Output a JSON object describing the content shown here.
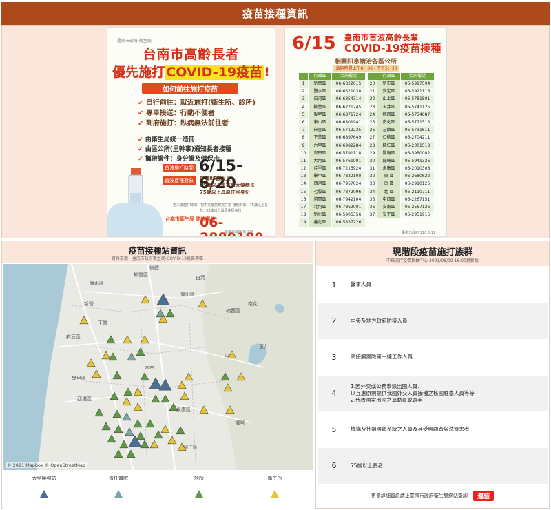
{
  "header": {
    "title": "疫苗接種資訊"
  },
  "poster_left": {
    "org": "臺南市政府 衛生局",
    "title_line1": "台南市高齡長者",
    "title_line2_prefix": "優先施打",
    "title_line2_highlight": "COVID-19疫苗",
    "title_line2_suffix": "!",
    "banner": "如何前往施打疫苗",
    "ways": [
      "自行前往：就近施打(衛生所、診所)",
      "專車接送：行動不便者",
      "到府施打：臥病無法前往者"
    ],
    "steps": [
      "由衛生局統一造冊",
      "由區公所(里幹事)通知長者接種",
      "攜帶證件：身分證及健保卡"
    ],
    "date_tag": "首波施打時間",
    "date": "6/15-6/20",
    "target_tag": "首波接種對象",
    "targets": [
      "年滿85歲以上",
      "75歲以上患有重大傷病卡",
      "75歲以上具原住民身份"
    ],
    "note": "第二波施打時間：視中央疫苗到貨訂定 接種對象：75歲以上長者、65歲以上具原住民身份",
    "hotline_tag": "台南市衛生局 諮詢專線",
    "hotline": "06-2880180",
    "footer": "臺南市政府 衛生局"
  },
  "poster_right": {
    "date": "6/15",
    "title_line1": "臺南市首波高齡長輩",
    "title_line2": "COVID-19疫苗接種",
    "subtitle": "相關訊息請洽各區公所",
    "time": "洽詢時間上午8：00 - 下午5：30",
    "head_no": "",
    "head_district": "行政區",
    "head_phone": "洽詢電話",
    "left_rows": [
      [
        "1",
        "新營區",
        "06-6322015"
      ],
      [
        "2",
        "鹽水區",
        "06-6521038"
      ],
      [
        "3",
        "白河區",
        "06-6854314"
      ],
      [
        "4",
        "柳營區",
        "06-6221245"
      ],
      [
        "5",
        "後壁區",
        "06-6871724"
      ],
      [
        "6",
        "東山區",
        "06-6801941"
      ],
      [
        "7",
        "麻豆區",
        "06-5712235"
      ],
      [
        "8",
        "下營區",
        "06-6897649"
      ],
      [
        "9",
        "六甲區",
        "06-6982284"
      ],
      [
        "10",
        "官田區",
        "06-5791118"
      ],
      [
        "11",
        "大內區",
        "06-5761001"
      ],
      [
        "12",
        "佳里區",
        "06-7215924"
      ],
      [
        "13",
        "學甲區",
        "06-7832100"
      ],
      [
        "14",
        "西港區",
        "06-7957024"
      ],
      [
        "15",
        "七股區",
        "06-7872096"
      ],
      [
        "16",
        "將軍區",
        "06-7942104"
      ],
      [
        "17",
        "北門區",
        "06-7862001"
      ],
      [
        "18",
        "新化區",
        "06-5905356"
      ],
      [
        "19",
        "善化區",
        "06-5837226"
      ]
    ],
    "right_rows": [
      [
        "20",
        "新市區",
        "06-5997594"
      ],
      [
        "21",
        "安定區",
        "06-5921116"
      ],
      [
        "22",
        "山上區",
        "06-5781801"
      ],
      [
        "23",
        "玉井區",
        "06-5741125"
      ],
      [
        "24",
        "楠西區",
        "06-5754687"
      ],
      [
        "25",
        "南化區",
        "06-5771513"
      ],
      [
        "26",
        "左鎮區",
        "06-5731611"
      ],
      [
        "27",
        "仁德區",
        "06-2704211"
      ],
      [
        "28",
        "歸仁區",
        "06-2301518"
      ],
      [
        "29",
        "關廟區",
        "06-5950082"
      ],
      [
        "30",
        "龍崎區",
        "06-5941326"
      ],
      [
        "31",
        "永康區",
        "06-2010308"
      ],
      [
        "32",
        "東 區",
        "06-2680622"
      ],
      [
        "33",
        "南 區",
        "06-2910126"
      ],
      [
        "34",
        "北 區",
        "06-2110711"
      ],
      [
        "35",
        "中西區",
        "06-2267151"
      ],
      [
        "36",
        "安南區",
        "06-2567126"
      ],
      [
        "37",
        "安平區",
        "06-2951915"
      ]
    ],
    "footer": "臺南市政府 110.6.11"
  },
  "map_card": {
    "title": "疫苗接種站資訊",
    "source": "資料來源：臺南市政府衛生局-COVID-19疫苗專區",
    "credit": "© 2021 Mapbox © OpenStreetMap",
    "places": [
      "鹽水區",
      "柳營區",
      "後壁",
      "白河",
      "新營",
      "東山區",
      "下營",
      "麻豆區",
      "學甲區",
      "西港區",
      "永康區",
      "歸仁區",
      "龍崎",
      "大內",
      "南化",
      "玉井",
      "山上",
      "楠西區"
    ],
    "legend": [
      {
        "label": "大型接種站",
        "color": "#4a6e96"
      },
      {
        "label": "責任醫院",
        "color": "#7aa6aa"
      },
      {
        "label": "診所",
        "color": "#5f9a49"
      },
      {
        "label": "衛生所",
        "color": "#e2c53a"
      }
    ]
  },
  "group_card": {
    "title": "現階段疫苗施打族群",
    "source": "中央流行疫情指揮中心 2021/06/09 16:00更新版",
    "groups": [
      {
        "num": "1",
        "lines": [
          "醫事人員"
        ]
      },
      {
        "num": "2",
        "lines": [
          "中央及地方政府防疫人員"
        ]
      },
      {
        "num": "3",
        "lines": [
          "高接觸風險第一線工作人員"
        ]
      },
      {
        "num": "4",
        "lines": [
          "1.因外交或公務奉派出國人員、",
          "  以互惠原則提供我國外交人員接種之核國駐臺人員等等",
          "2.代表國家出國之運動員或選手"
        ]
      },
      {
        "num": "5",
        "lines": [
          "機構及社福照顧系統之人員及其受照顧者與洗腎患者"
        ]
      },
      {
        "num": "6",
        "lines": [
          "75歲以上長者"
        ]
      }
    ],
    "footer_text": "更多詳細資訊請上臺南市政府衛生局網站查詢",
    "link_label": "連結"
  }
}
